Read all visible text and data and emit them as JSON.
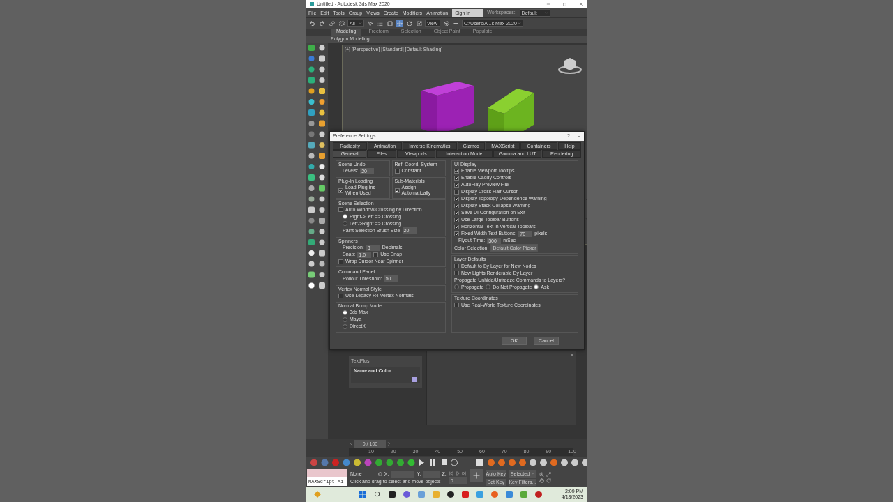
{
  "window": {
    "title": "Untitled - Autodesk 3ds Max 2020"
  },
  "menu": [
    "File",
    "Edit",
    "Tools",
    "Group",
    "Views",
    "Create",
    "Modifiers",
    "Animation"
  ],
  "account": {
    "sign_in": "Sign In",
    "workspaces_label": "Workspaces:",
    "workspace": "Default"
  },
  "toolbar": {
    "selection_filter": "All",
    "reference": "View",
    "project_path": "C:\\Users\\A...s Max 2020"
  },
  "ribbon": {
    "tabs": [
      {
        "label": "Modeling",
        "selected": true
      },
      {
        "label": "Freeform",
        "selected": false
      },
      {
        "label": "Selection",
        "selected": false
      },
      {
        "label": "Object Paint",
        "selected": false
      },
      {
        "label": "Populate",
        "selected": false
      }
    ],
    "panel": "Polygon Modeling"
  },
  "viewport": {
    "label": "[+] [Perspective] [Standard] [Default Shading]"
  },
  "command_panel": {
    "item": "TextPlus",
    "rollout": "Name and Color"
  },
  "dialog": {
    "title": "Preference Settings",
    "help": "?",
    "tabs_top": [
      {
        "label": "Radiosity",
        "selected": false
      },
      {
        "label": "Animation",
        "selected": false
      },
      {
        "label": "Inverse Kinematics",
        "selected": false
      },
      {
        "label": "Gizmos",
        "selected": false
      },
      {
        "label": "MAXScript",
        "selected": false
      },
      {
        "label": "Containers",
        "selected": false
      },
      {
        "label": "Help",
        "selected": false
      }
    ],
    "tabs_bottom": [
      {
        "label": "General",
        "selected": true
      },
      {
        "label": "Files",
        "selected": false
      },
      {
        "label": "Viewports",
        "selected": false
      },
      {
        "label": "Interaction Mode",
        "selected": false
      },
      {
        "label": "Gamma and LUT",
        "selected": false
      },
      {
        "label": "Rendering",
        "selected": false
      }
    ],
    "left": [
      {
        "groups": [
          {
            "title": "Scene Undo",
            "items": [
              {
                "kind": "spinner",
                "label": "Levels:",
                "value": "20"
              }
            ]
          },
          {
            "title": "Ref. Coord. System",
            "items": [
              {
                "kind": "checkbox",
                "label": "Constant",
                "checked": false
              }
            ]
          }
        ]
      },
      {
        "groups": [
          {
            "title": "Plug-In Loading",
            "items": [
              {
                "kind": "checkbox",
                "label": "Load Plug-ins When Used",
                "checked": true
              }
            ]
          },
          {
            "title": "Sub-Materials",
            "items": [
              {
                "kind": "checkbox",
                "label": "Assign Automatically",
                "checked": true
              }
            ]
          }
        ]
      },
      {
        "groups": [
          {
            "title": "Scene Selection",
            "items": [
              {
                "kind": "checkbox",
                "label": "Auto Window/Crossing by Direction",
                "checked": false
              },
              {
                "kind": "radio",
                "label": "Right->Left => Crossing",
                "selected": true
              },
              {
                "kind": "radio",
                "label": "Left->Right => Crossing",
                "selected": false
              },
              {
                "kind": "spinner",
                "label": "Paint Selection Brush Size",
                "value": "20"
              }
            ]
          }
        ]
      },
      {
        "groups": [
          {
            "title": "Spinners",
            "items": [
              {
                "kind": "spinner",
                "label": "Precision:",
                "value": "3",
                "unit": "Decimals"
              },
              {
                "kind": "spinner",
                "label": "Snap:",
                "value": "1.0",
                "check": {
                  "label": "Use Snap",
                  "checked": false
                }
              },
              {
                "kind": "checkbox",
                "label": "Wrap Cursor Near Spinner",
                "checked": false
              }
            ]
          }
        ]
      },
      {
        "groups": [
          {
            "title": "Command Panel",
            "items": [
              {
                "kind": "spinner",
                "label": "Rollout Threshold:",
                "value": "50"
              }
            ]
          }
        ]
      },
      {
        "groups": [
          {
            "title": "Vertex Normal Style",
            "items": [
              {
                "kind": "checkbox",
                "label": "Use Legacy R4 Vertex Normals",
                "checked": false
              }
            ]
          }
        ]
      },
      {
        "groups": [
          {
            "title": "Normal Bump Mode",
            "items": [
              {
                "kind": "radio",
                "label": "3ds Max",
                "selected": true
              },
              {
                "kind": "radio",
                "label": "Maya",
                "selected": false
              },
              {
                "kind": "radio",
                "label": "DirectX",
                "selected": false
              }
            ]
          }
        ]
      }
    ],
    "right": [
      {
        "title": "UI Display",
        "items": [
          {
            "kind": "checkbox",
            "label": "Enable Viewport Tooltips",
            "checked": true
          },
          {
            "kind": "checkbox",
            "label": "Enable Caddy Controls",
            "checked": true
          },
          {
            "kind": "checkbox",
            "label": "AutoPlay Preview File",
            "checked": true
          },
          {
            "kind": "checkbox",
            "label": "Display Cross Hair Cursor",
            "checked": false
          },
          {
            "kind": "checkbox",
            "label": "Display Topology-Dependence Warning",
            "checked": true
          },
          {
            "kind": "checkbox",
            "label": "Display Stack Collapse Warning",
            "checked": true
          },
          {
            "kind": "checkbox",
            "label": "Save UI Configuration on Exit",
            "checked": true
          },
          {
            "kind": "checkbox",
            "label": "Use Large Toolbar Buttons",
            "checked": true
          },
          {
            "kind": "checkbox",
            "label": "Horizontal Text in Vertical Toolbars",
            "checked": true
          },
          {
            "kind": "check_spinner",
            "label": "Fixed Width Text Buttons:",
            "checked": true,
            "value": "70",
            "unit": "pixels"
          },
          {
            "kind": "spinner",
            "label": "Flyout Time:",
            "value": "300",
            "unit": "mSec"
          },
          {
            "kind": "dropdown",
            "label": "Color Selection:",
            "value": "Default Color Picker"
          }
        ]
      },
      {
        "title": "Layer Defaults",
        "items": [
          {
            "kind": "checkbox",
            "label": "Default to By Layer for New Nodes",
            "checked": false
          },
          {
            "kind": "checkbox",
            "label": "New Lights Renderable By Layer",
            "checked": false
          },
          {
            "kind": "text",
            "label": "Propagate Unhide/Unfreeze Commands to Layers?"
          },
          {
            "kind": "radio_row",
            "options": [
              {
                "label": "Propagate",
                "selected": false
              },
              {
                "label": "Do Not Propagate",
                "selected": false
              },
              {
                "label": "Ask",
                "selected": true
              }
            ]
          }
        ]
      },
      {
        "title": "Texture Coordinates",
        "items": [
          {
            "kind": "checkbox",
            "label": "Use Real-World Texture Coordinates",
            "checked": false
          }
        ]
      }
    ],
    "buttons": [
      "OK",
      "Cancel"
    ]
  },
  "timeline": {
    "frame": "0 / 100",
    "ticks": [
      "10",
      "20",
      "30",
      "40",
      "50",
      "60",
      "70",
      "80",
      "90",
      "100"
    ]
  },
  "status": {
    "listener": "MAXScript Mi:",
    "selection": "None",
    "x_label": "X:",
    "y_label": "Y:",
    "z_label": "Z:",
    "prompt": "Click and drag to select and move objects",
    "current_frame": "0",
    "auto_key": "Auto Key",
    "key_mode": "Selected",
    "set_key": "Set Key",
    "key_filters": "Key Filters..."
  },
  "taskbar": {
    "time": "2:09 PM",
    "date": "4/18/2023"
  }
}
